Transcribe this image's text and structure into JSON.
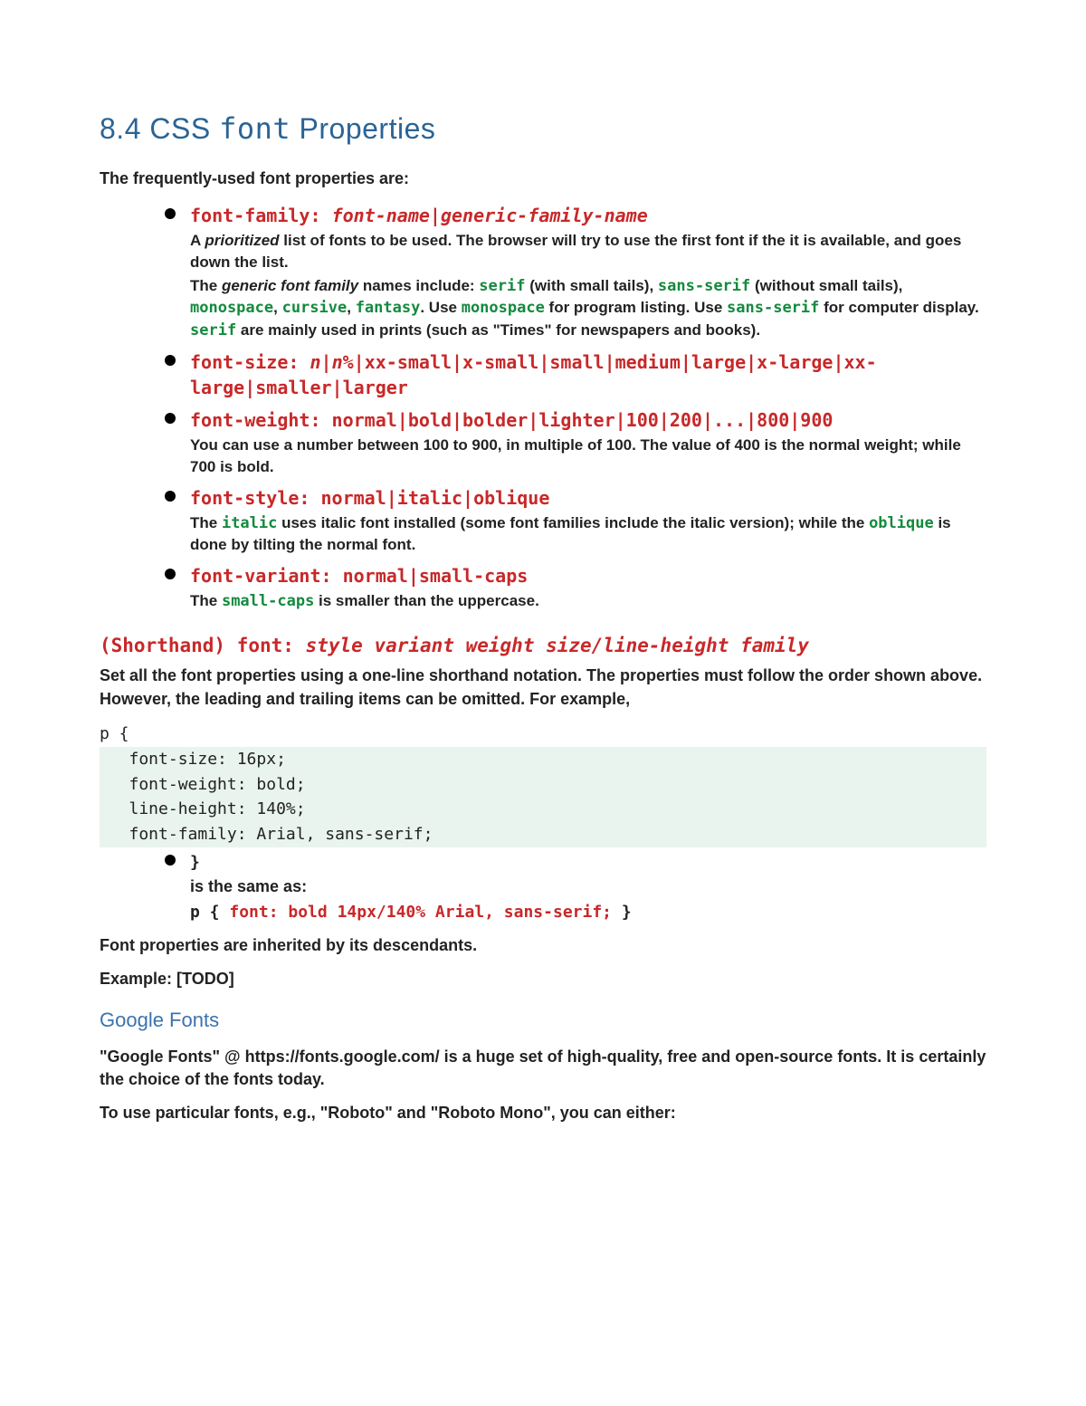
{
  "heading": {
    "number": "8.4",
    "prefix": "CSS",
    "code": "font",
    "suffix": "Properties"
  },
  "intro": "The frequently-used font properties are:",
  "props": {
    "family": {
      "sig_key": "font-family:",
      "sig_arg": "font-name|generic-family-name",
      "desc1_pre": "A ",
      "desc1_em": "prioritized",
      "desc1_post": " list of fonts to be used. The browser will try to use the first font if the it is available, and goes down the list.",
      "desc2_pre": "The ",
      "desc2_em": "generic font family",
      "desc2_mid": " names include: ",
      "kw_serif": "serif",
      "desc2_serif": " (with small tails), ",
      "kw_sans": "sans-serif",
      "desc2_sans": " (without small tails), ",
      "kw_mono": "monospace",
      "sep1": ", ",
      "kw_cursive": "cursive",
      "sep2": ", ",
      "kw_fantasy": "fantasy",
      "desc2_use1": ". Use ",
      "kw_mono2": "monospace",
      "desc2_use1b": " for program listing. Use ",
      "kw_sans2": "sans-serif",
      "desc2_use2": " for computer display. ",
      "kw_serif2": "serif",
      "desc2_tail": " are mainly used in prints (such as \"Times\" for newspapers and books)."
    },
    "size": {
      "sig_key": "font-size:",
      "sig_arg_a": "n",
      "sig_pipe1": "|",
      "sig_arg_b": "n",
      "sig_rest": "%|xx-small|x-small|small|medium|large|x-large|xx-large|smaller|larger"
    },
    "weight": {
      "sig_key": "font-weight:",
      "sig_rest": "normal|bold|bolder|lighter|100|200|...|800|900",
      "desc": "You can use a number between 100 to 900, in multiple of 100. The value of 400 is the normal weight; while 700 is bold."
    },
    "style": {
      "sig_key": "font-style:",
      "sig_rest": "normal|italic|oblique",
      "desc_pre": "The ",
      "kw_italic": "italic",
      "desc_mid": " uses italic font installed (some font families include the italic version); while the ",
      "kw_oblique": "oblique",
      "desc_post": " is done by tilting the normal font."
    },
    "variant": {
      "sig_key": "font-variant:",
      "sig_rest": "normal|small-caps",
      "desc_pre": "The ",
      "kw_smallcaps": "small-caps",
      "desc_post": " is smaller than the uppercase."
    }
  },
  "shorthand": {
    "label": "(Shorthand)",
    "key": "font:",
    "arg": "style variant weight size/line-height family",
    "desc": "Set all the font properties using a one-line shorthand notation. The properties must follow the order shown above. However, the leading and trailing items can be omitted. For example,",
    "code_open": "p {",
    "code_l1": "   font-size: 16px;",
    "code_l2": "   font-weight: bold;",
    "code_l3": "   line-height: 140%;",
    "code_l4": "   font-family: Arial, sans-serif;",
    "close_brace": "}",
    "same_as": "is the same as:",
    "one_open": "p { ",
    "one_decl": "font: bold 14px/140% Arial, sans-serif;",
    "one_close": " }"
  },
  "inherit": "Font properties are inherited by its descendants.",
  "example": "Example: [TODO]",
  "google": {
    "heading": "Google Fonts",
    "p1": "\"Google Fonts\" @ https://fonts.google.com/ is a huge set of high-quality, free and open-source fonts. It is certainly the choice of the fonts today.",
    "p2": "To use particular fonts, e.g., \"Roboto\" and \"Roboto Mono\", you can either:"
  }
}
